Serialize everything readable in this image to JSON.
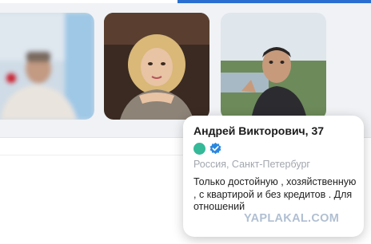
{
  "profile_tiles": [
    {
      "icon": "blurred-person-photo"
    },
    {
      "icon": "woman-portrait-photo"
    },
    {
      "icon": "man-selfie-photo"
    }
  ],
  "popup": {
    "name": "Андрей Викторович, 37",
    "online_color": "#36b999",
    "verified_color": "#2a87e0",
    "location": "Россия, Санкт-Петербург",
    "about": "Только достойную , хозяйственную , с квартирой и без кредитов . Для отношений"
  },
  "watermark": "YAPLAKAL.COM",
  "colors": {
    "accent": "#2a6fd0",
    "background": "#f0f2f5"
  }
}
